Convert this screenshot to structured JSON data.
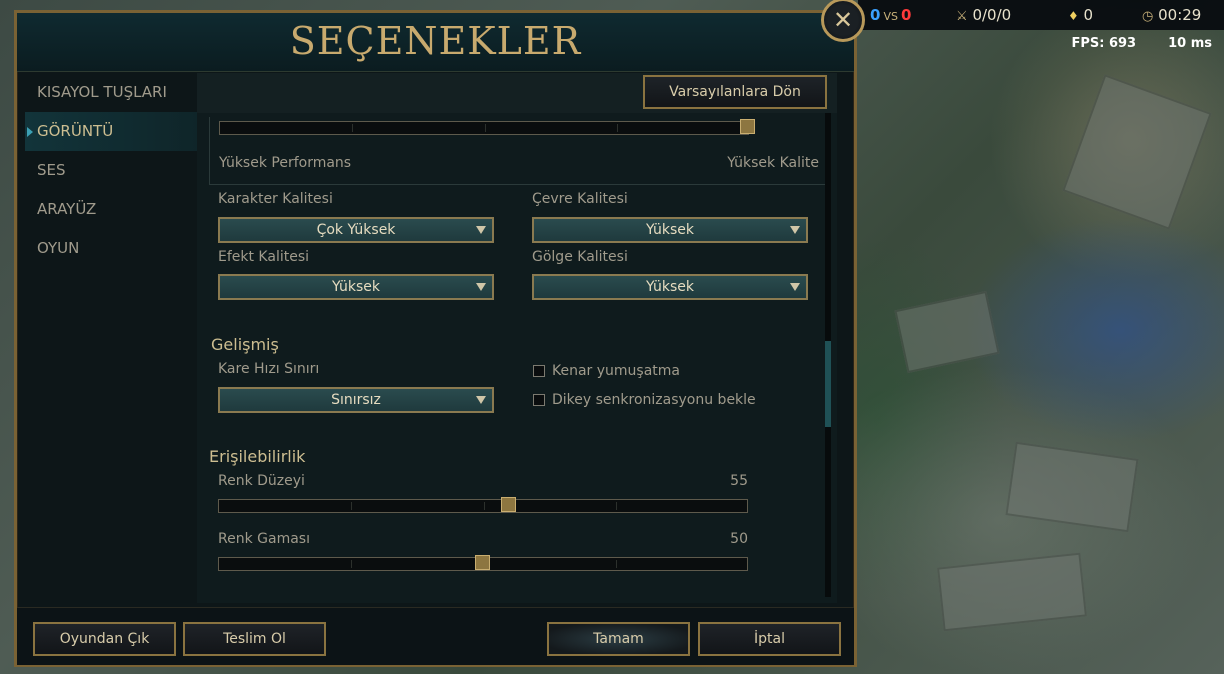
{
  "title": "SEÇENEKLER",
  "sidebar": {
    "items": [
      {
        "label": "KISAYOL TUŞLARI"
      },
      {
        "label": "GÖRÜNTÜ"
      },
      {
        "label": "SES"
      },
      {
        "label": "ARAYÜZ"
      },
      {
        "label": "OYUN"
      }
    ],
    "active_index": 1
  },
  "reset_button": "Varsayılanlara Dön",
  "quality_slider": {
    "left_label": "Yüksek Performans",
    "right_label": "Yüksek Kalite",
    "level": 1.0
  },
  "dropdowns": {
    "character_quality": {
      "label": "Karakter Kalitesi",
      "value": "Çok Yüksek"
    },
    "environment_quality": {
      "label": "Çevre Kalitesi",
      "value": "Yüksek"
    },
    "effect_quality": {
      "label": "Efekt Kalitesi",
      "value": "Yüksek"
    },
    "shadow_quality": {
      "label": "Gölge Kalitesi",
      "value": "Yüksek"
    }
  },
  "advanced": {
    "title": "Gelişmiş",
    "frame_rate_label": "Kare Hızı Sınırı",
    "frame_rate_value": "Sınırsız",
    "anti_aliasing": {
      "label": "Kenar yumuşatma",
      "checked": false
    },
    "vsync": {
      "label": "Dikey senkronizasyonu bekle",
      "checked": false
    }
  },
  "accessibility": {
    "title": "Erişilebilirlik",
    "color_level": {
      "label": "Renk Düzeyi",
      "value": "55",
      "fraction": 0.55
    },
    "color_gamma": {
      "label": "Renk Gaması",
      "value": "50",
      "fraction": 0.5
    }
  },
  "footer": {
    "exit_game": "Oyundan Çık",
    "surrender": "Teslim Ol",
    "ok": "Tamam",
    "cancel": "İptal"
  },
  "hud": {
    "score_blue": "0",
    "vs": "VS",
    "score_red": "0",
    "kda": "0/0/0",
    "cs": "0",
    "time": "00:29",
    "fps": "FPS: 693",
    "ping": "10 ms"
  },
  "colors": {
    "accent_gold": "#c8aa6e",
    "blue_team": "#3aa0ff",
    "red_team": "#ff3a3a"
  }
}
